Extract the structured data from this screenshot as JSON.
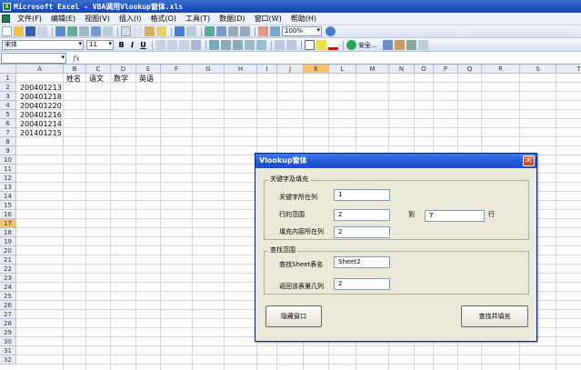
{
  "window": {
    "title": "Microsoft Excel - VBA调用Vlookup窗体.xls"
  },
  "menu": [
    "文件(F)",
    "编辑(E)",
    "视图(V)",
    "插入(I)",
    "格式(O)",
    "工具(T)",
    "数据(D)",
    "窗口(W)",
    "帮助(H)"
  ],
  "toolbar": {
    "zoom": "100%",
    "font_name": "宋体",
    "font_size": "11",
    "bold": "B",
    "italic": "I",
    "underline": "U",
    "security_label": "安全..."
  },
  "formula_bar": {
    "name_box": "",
    "fx": "fx",
    "content": ""
  },
  "columns": [
    "A",
    "B",
    "C",
    "D",
    "E",
    "F",
    "G",
    "H",
    "I",
    "J",
    "K",
    "L",
    "M",
    "N",
    "O",
    "P",
    "Q",
    "R",
    "S",
    "T"
  ],
  "rows": [
    "1",
    "2",
    "3",
    "4",
    "5",
    "6",
    "7",
    "8",
    "9",
    "10",
    "11",
    "12",
    "13",
    "14",
    "15",
    "16",
    "17",
    "18",
    "19",
    "20",
    "21",
    "22",
    "23",
    "24",
    "25",
    "26",
    "27",
    "28",
    "29",
    "30",
    "31",
    "32"
  ],
  "active_column": "K",
  "active_row": "17",
  "sheet": {
    "headers": [
      "姓名",
      "语文",
      "数学",
      "英语"
    ],
    "ids": [
      "200401213",
      "200401218",
      "200401220",
      "200401216",
      "200401214",
      "201401215"
    ]
  },
  "dialog": {
    "title": "Vlookup窗体",
    "frame1_label": "关键字及填充",
    "key_col_label": "关键字所在列",
    "key_col_value": "1",
    "row_range_label": "行的范围",
    "row_from_value": "2",
    "to_label": "到",
    "row_to_value": "7",
    "row_suffix": "行",
    "fill_col_label": "填充内容所在列",
    "fill_col_value": "2",
    "frame2_label": "查找范围",
    "sheet_name_label": "查找Sheet表名",
    "sheet_name_value": "Sheet2",
    "return_col_label": "返回该表第几列",
    "return_col_value": "2",
    "hide_button": "隐藏窗口",
    "find_button": "查找并填充"
  }
}
